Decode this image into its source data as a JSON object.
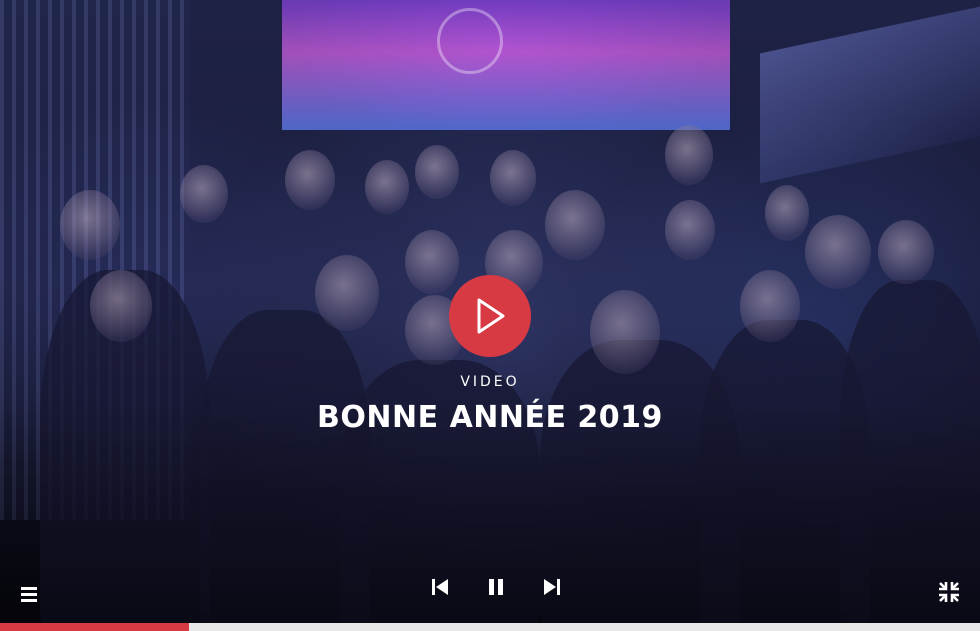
{
  "video": {
    "kicker": "VIDEO",
    "title": "BONNE ANNÉE 2019",
    "progress_fraction": 0.193
  },
  "controls": {
    "menu_icon": "menu-icon",
    "previous_icon": "skip-previous-icon",
    "pause_icon": "pause-icon",
    "next_icon": "skip-next-icon",
    "exit_fullscreen_icon": "exit-fullscreen-icon",
    "play_icon": "play-icon"
  },
  "colors": {
    "accent": "#d83a44",
    "progress_track": "#e8e8e8",
    "icon": "#ffffff"
  }
}
